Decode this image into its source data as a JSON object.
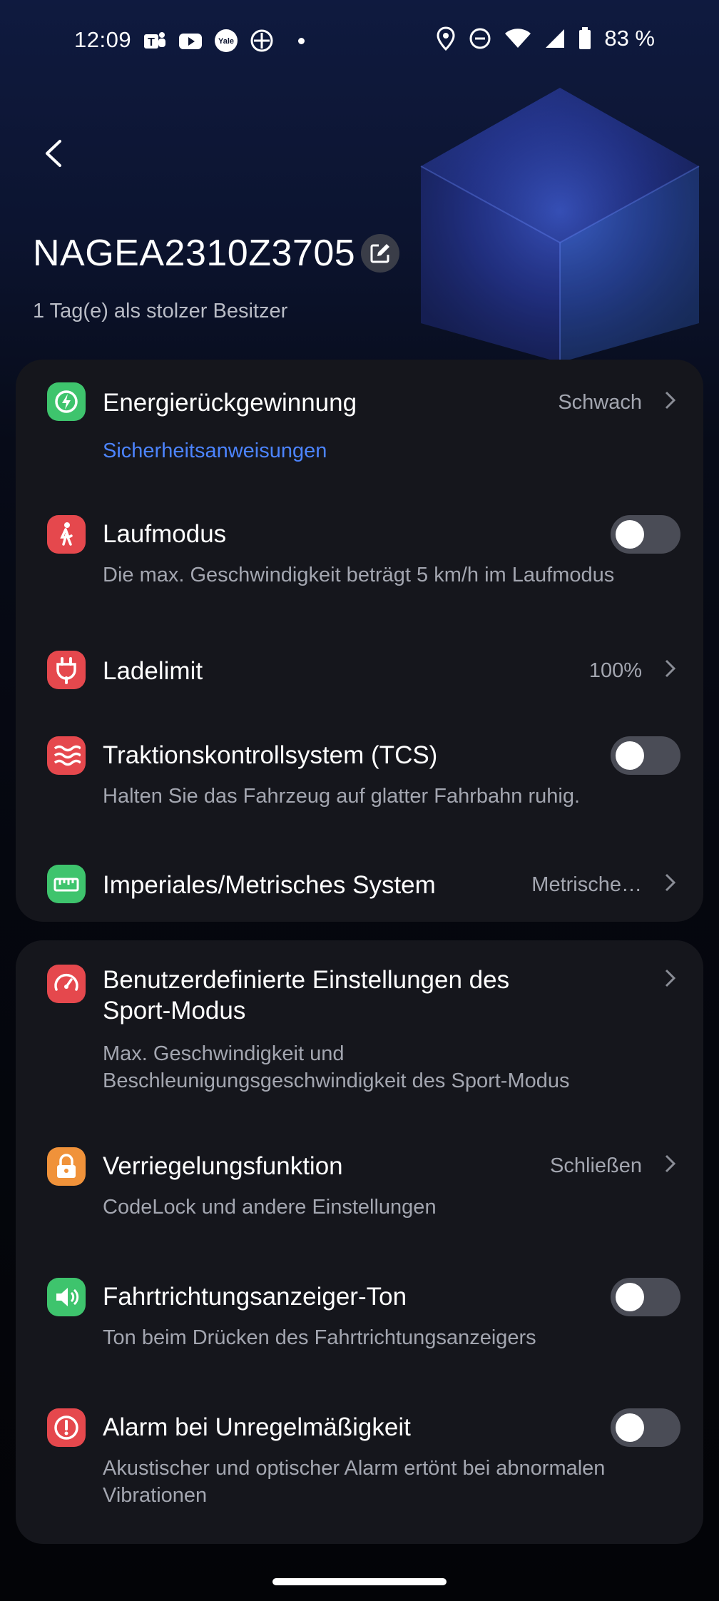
{
  "status_bar": {
    "time": "12:09",
    "battery": "83 %",
    "left_icons": [
      "teams-icon",
      "youtube-icon",
      "yale-icon",
      "accessibility-icon",
      "notification-dot"
    ],
    "right_icons": [
      "location-icon",
      "dnd-icon",
      "wifi-icon",
      "cell-signal-icon",
      "battery-icon"
    ]
  },
  "header": {
    "device_name": "NAGEA2310Z3705",
    "owner_text": "1 Tag(e) als stolzer Besitzer"
  },
  "card1": {
    "energy": {
      "title": "Energierückgewinnung",
      "value": "Schwach",
      "link": "Sicherheitsanweisungen",
      "icon": "energy-recovery-icon",
      "icon_color": "#3ec46d"
    },
    "walk_mode": {
      "title": "Laufmodus",
      "sub": "Die max. Geschwindigkeit beträgt 5 km/h im Laufmodus",
      "enabled": false,
      "icon": "walking-person-icon",
      "icon_color": "#e5484d"
    },
    "charge_limit": {
      "title": "Ladelimit",
      "value": "100%",
      "icon": "plug-icon",
      "icon_color": "#e5484d"
    },
    "tcs": {
      "title": "Traktionskontrollsystem (TCS)",
      "sub": "Halten Sie das Fahrzeug auf glatter Fahrbahn ruhig.",
      "enabled": false,
      "icon": "traction-waves-icon",
      "icon_color": "#e5484d"
    },
    "units": {
      "title": "Imperiales/Metrisches System",
      "value": "Metrische…",
      "icon": "ruler-icon",
      "icon_color": "#3ec46d"
    }
  },
  "card2": {
    "sport": {
      "title_line1": "Benutzerdefinierte Einstellungen des",
      "title_line2": "Sport-Modus",
      "sub_line1": "Max. Geschwindigkeit und",
      "sub_line2": "Beschleunigungsgeschwindigkeit des Sport-Modus",
      "icon": "speedometer-icon",
      "icon_color": "#e5484d"
    },
    "lock": {
      "title": "Verriegelungsfunktion",
      "value": "Schließen",
      "sub": "CodeLock und andere Einstellungen",
      "icon": "lock-icon",
      "icon_color": "#f0923a"
    },
    "indicator_sound": {
      "title": "Fahrtrichtungsanzeiger-Ton",
      "sub": "Ton beim Drücken des Fahrtrichtungsanzeigers",
      "enabled": false,
      "icon": "speaker-icon",
      "icon_color": "#3ec46d"
    },
    "alarm": {
      "title": "Alarm bei Unregelmäßigkeit",
      "sub_line1": "Akustischer und optischer Alarm ertönt bei abnormalen",
      "sub_line2": "Vibrationen",
      "enabled": false,
      "icon": "alert-icon",
      "icon_color": "#e5484d"
    }
  }
}
